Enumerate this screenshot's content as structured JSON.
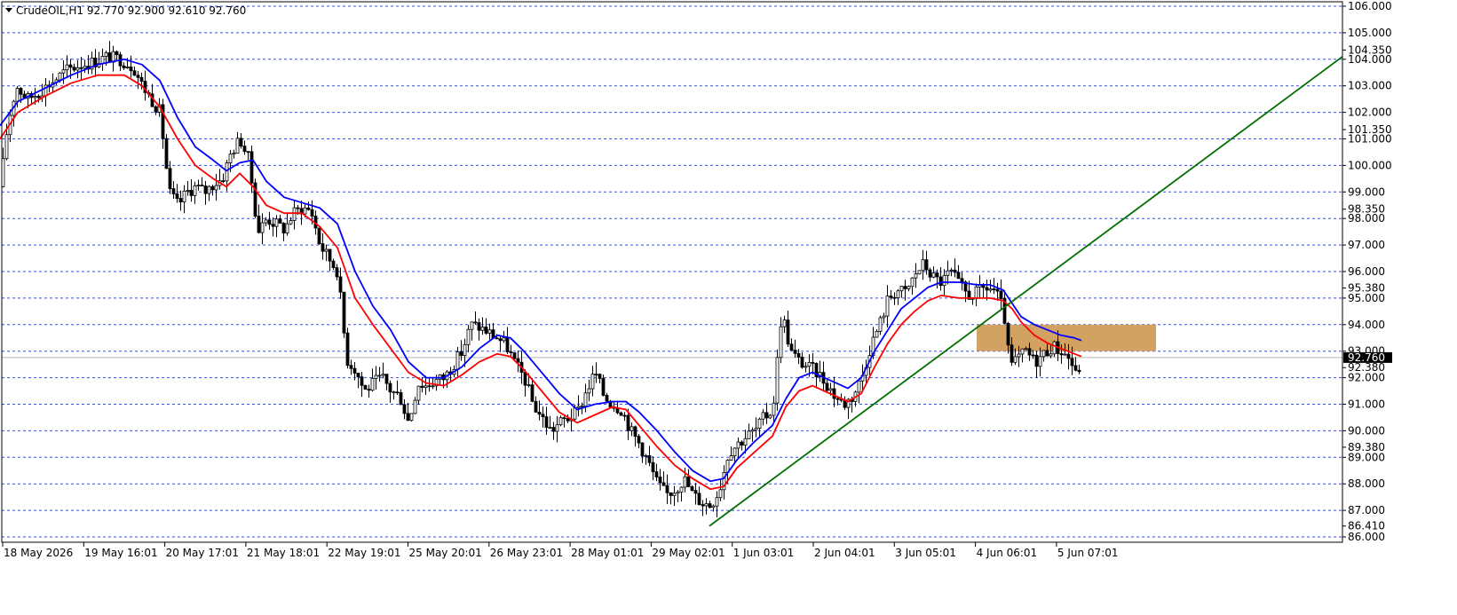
{
  "header": {
    "symbol_line": "CrudeOIL,H1  92.770 92.900 92.610 92.760"
  },
  "colors": {
    "background": "#ffffff",
    "grid": "#3b4fd0",
    "candle": "#000000",
    "ma_fast": "#ff0000",
    "ma_slow": "#0000ff",
    "trendline": "#007000",
    "zone_fill": "#d2a262",
    "current_price_bg": "#000000"
  },
  "chart_data": {
    "type": "candlestick",
    "ylim": [
      86.0,
      106.0
    ],
    "grid": true,
    "y_ticks": [
      "106.000",
      "105.000",
      "104.350",
      "104.000",
      "103.000",
      "102.000",
      "101.350",
      "101.000",
      "100.000",
      "99.000",
      "98.350",
      "98.000",
      "97.000",
      "96.000",
      "95.380",
      "95.000",
      "94.000",
      "93.000",
      "92.380",
      "92.000",
      "91.000",
      "90.000",
      "89.380",
      "89.000",
      "88.000",
      "87.000",
      "86.410",
      "86.000"
    ],
    "gridlines": [
      106,
      105,
      104,
      103,
      102,
      101,
      100,
      99,
      98,
      97,
      96,
      95,
      94,
      93,
      92,
      91,
      90,
      89,
      88,
      87,
      86
    ],
    "x_tick_labels": [
      "18 May 2026",
      "19 May 16:01",
      "20 May 17:01",
      "21 May 18:01",
      "22 May 19:01",
      "25 May 20:01",
      "26 May 23:01",
      "28 May 01:01",
      "29 May 02:01",
      "1 Jun 03:01",
      "2 Jun 04:01",
      "3 Jun 05:01",
      "4 Jun 06:01",
      "5 Jun 07:01"
    ],
    "current_price": "92.760",
    "close_path": [
      [
        0,
        99.2
      ],
      [
        8,
        101.5
      ],
      [
        18,
        103.0
      ],
      [
        30,
        102.5
      ],
      [
        45,
        102.8
      ],
      [
        60,
        103.2
      ],
      [
        75,
        103.6
      ],
      [
        90,
        103.8
      ],
      [
        105,
        103.9
      ],
      [
        120,
        104.1
      ],
      [
        135,
        104.0
      ],
      [
        150,
        103.7
      ],
      [
        160,
        103.0
      ],
      [
        170,
        102.5
      ],
      [
        180,
        102.0
      ],
      [
        190,
        99.0
      ],
      [
        200,
        98.5
      ],
      [
        210,
        99.0
      ],
      [
        220,
        99.2
      ],
      [
        230,
        99.0
      ],
      [
        240,
        99.3
      ],
      [
        250,
        99.5
      ],
      [
        260,
        100.5
      ],
      [
        270,
        101.0
      ],
      [
        280,
        100.2
      ],
      [
        290,
        97.5
      ],
      [
        300,
        98.0
      ],
      [
        310,
        97.8
      ],
      [
        320,
        97.6
      ],
      [
        330,
        98.2
      ],
      [
        340,
        98.4
      ],
      [
        350,
        98.3
      ],
      [
        360,
        97.0
      ],
      [
        370,
        96.5
      ],
      [
        380,
        96.0
      ],
      [
        390,
        92.7
      ],
      [
        400,
        92.3
      ],
      [
        410,
        91.5
      ],
      [
        420,
        91.8
      ],
      [
        430,
        92.0
      ],
      [
        440,
        91.5
      ],
      [
        450,
        91.3
      ],
      [
        460,
        90.3
      ],
      [
        470,
        91.8
      ],
      [
        480,
        91.7
      ],
      [
        490,
        91.9
      ],
      [
        500,
        92.0
      ],
      [
        510,
        92.5
      ],
      [
        520,
        93.0
      ],
      [
        530,
        94.0
      ],
      [
        540,
        93.9
      ],
      [
        550,
        93.7
      ],
      [
        560,
        93.5
      ],
      [
        570,
        93.2
      ],
      [
        580,
        92.5
      ],
      [
        590,
        92.0
      ],
      [
        600,
        91.0
      ],
      [
        610,
        90.5
      ],
      [
        620,
        90.0
      ],
      [
        630,
        90.3
      ],
      [
        640,
        90.5
      ],
      [
        650,
        90.7
      ],
      [
        660,
        91.5
      ],
      [
        670,
        92.2
      ],
      [
        680,
        91.3
      ],
      [
        690,
        91.0
      ],
      [
        700,
        90.8
      ],
      [
        710,
        90.0
      ],
      [
        720,
        89.5
      ],
      [
        730,
        88.8
      ],
      [
        740,
        88.0
      ],
      [
        750,
        87.6
      ],
      [
        760,
        87.8
      ],
      [
        770,
        88.2
      ],
      [
        780,
        87.6
      ],
      [
        790,
        87.3
      ],
      [
        800,
        87.2
      ],
      [
        810,
        87.8
      ],
      [
        820,
        89.2
      ],
      [
        830,
        89.5
      ],
      [
        840,
        89.8
      ],
      [
        850,
        90.0
      ],
      [
        860,
        90.5
      ],
      [
        870,
        90.8
      ],
      [
        880,
        94.5
      ],
      [
        890,
        93.0
      ],
      [
        900,
        92.6
      ],
      [
        910,
        92.4
      ],
      [
        920,
        92.2
      ],
      [
        930,
        91.8
      ],
      [
        940,
        91.3
      ],
      [
        950,
        91.0
      ],
      [
        960,
        91.3
      ],
      [
        970,
        92.0
      ],
      [
        980,
        93.2
      ],
      [
        990,
        94.0
      ],
      [
        1000,
        95.0
      ],
      [
        1010,
        95.3
      ],
      [
        1020,
        95.2
      ],
      [
        1030,
        95.9
      ],
      [
        1040,
        96.3
      ],
      [
        1050,
        95.8
      ],
      [
        1060,
        95.6
      ],
      [
        1070,
        96.0
      ],
      [
        1080,
        95.5
      ],
      [
        1090,
        95.1
      ],
      [
        1100,
        95.2
      ],
      [
        1110,
        95.4
      ],
      [
        1120,
        95.3
      ],
      [
        1130,
        94.5
      ],
      [
        1137,
        92.4
      ],
      [
        1145,
        92.7
      ],
      [
        1155,
        93.0
      ],
      [
        1165,
        92.6
      ],
      [
        1175,
        92.9
      ],
      [
        1185,
        93.2
      ],
      [
        1195,
        93.0
      ],
      [
        1205,
        92.7
      ],
      [
        1212,
        92.0
      ],
      [
        1218,
        92.76
      ]
    ],
    "ma_fast": [
      [
        0,
        101.0
      ],
      [
        20,
        102.0
      ],
      [
        50,
        102.6
      ],
      [
        80,
        103.1
      ],
      [
        110,
        103.4
      ],
      [
        140,
        103.4
      ],
      [
        160,
        103.0
      ],
      [
        180,
        102.2
      ],
      [
        200,
        101.0
      ],
      [
        220,
        100.0
      ],
      [
        240,
        99.5
      ],
      [
        255,
        99.2
      ],
      [
        270,
        99.7
      ],
      [
        285,
        99.2
      ],
      [
        300,
        98.5
      ],
      [
        320,
        98.2
      ],
      [
        340,
        98.2
      ],
      [
        360,
        97.7
      ],
      [
        380,
        96.9
      ],
      [
        400,
        95.0
      ],
      [
        420,
        94.0
      ],
      [
        440,
        93.1
      ],
      [
        460,
        92.2
      ],
      [
        480,
        91.8
      ],
      [
        500,
        91.7
      ],
      [
        520,
        92.1
      ],
      [
        540,
        92.6
      ],
      [
        560,
        92.9
      ],
      [
        575,
        92.8
      ],
      [
        590,
        92.3
      ],
      [
        610,
        91.5
      ],
      [
        630,
        90.7
      ],
      [
        650,
        90.3
      ],
      [
        670,
        90.6
      ],
      [
        690,
        90.9
      ],
      [
        705,
        90.8
      ],
      [
        720,
        90.2
      ],
      [
        740,
        89.4
      ],
      [
        760,
        88.7
      ],
      [
        780,
        88.2
      ],
      [
        800,
        87.8
      ],
      [
        815,
        87.9
      ],
      [
        830,
        88.6
      ],
      [
        850,
        89.2
      ],
      [
        870,
        89.8
      ],
      [
        885,
        90.9
      ],
      [
        900,
        91.5
      ],
      [
        915,
        91.7
      ],
      [
        935,
        91.4
      ],
      [
        955,
        91.1
      ],
      [
        970,
        91.4
      ],
      [
        985,
        92.4
      ],
      [
        1000,
        93.3
      ],
      [
        1015,
        94.0
      ],
      [
        1030,
        94.5
      ],
      [
        1045,
        94.9
      ],
      [
        1060,
        95.1
      ],
      [
        1080,
        95.0
      ],
      [
        1100,
        95.0
      ],
      [
        1115,
        95.0
      ],
      [
        1130,
        94.9
      ],
      [
        1140,
        94.6
      ],
      [
        1150,
        94.1
      ],
      [
        1165,
        93.6
      ],
      [
        1180,
        93.3
      ],
      [
        1195,
        93.1
      ],
      [
        1210,
        92.9
      ],
      [
        1218,
        92.8
      ]
    ],
    "ma_slow": [
      [
        0,
        101.5
      ],
      [
        20,
        102.4
      ],
      [
        50,
        102.9
      ],
      [
        80,
        103.4
      ],
      [
        110,
        103.8
      ],
      [
        140,
        104.0
      ],
      [
        160,
        103.8
      ],
      [
        180,
        103.2
      ],
      [
        200,
        101.8
      ],
      [
        220,
        100.7
      ],
      [
        240,
        100.2
      ],
      [
        255,
        99.8
      ],
      [
        270,
        100.1
      ],
      [
        285,
        100.2
      ],
      [
        300,
        99.4
      ],
      [
        320,
        98.8
      ],
      [
        340,
        98.6
      ],
      [
        360,
        98.4
      ],
      [
        380,
        97.8
      ],
      [
        400,
        96.0
      ],
      [
        420,
        94.7
      ],
      [
        440,
        93.8
      ],
      [
        460,
        92.6
      ],
      [
        480,
        92.0
      ],
      [
        500,
        92.0
      ],
      [
        520,
        92.4
      ],
      [
        540,
        93.1
      ],
      [
        560,
        93.6
      ],
      [
        575,
        93.5
      ],
      [
        590,
        93.0
      ],
      [
        610,
        92.2
      ],
      [
        630,
        91.4
      ],
      [
        650,
        90.8
      ],
      [
        670,
        91.0
      ],
      [
        690,
        91.1
      ],
      [
        705,
        91.1
      ],
      [
        720,
        90.7
      ],
      [
        740,
        90.0
      ],
      [
        760,
        89.2
      ],
      [
        780,
        88.5
      ],
      [
        800,
        88.1
      ],
      [
        815,
        88.2
      ],
      [
        830,
        88.9
      ],
      [
        850,
        89.6
      ],
      [
        870,
        90.2
      ],
      [
        885,
        91.2
      ],
      [
        900,
        92.0
      ],
      [
        915,
        92.2
      ],
      [
        935,
        91.9
      ],
      [
        955,
        91.6
      ],
      [
        970,
        92.0
      ],
      [
        985,
        93.0
      ],
      [
        1000,
        93.8
      ],
      [
        1015,
        94.6
      ],
      [
        1030,
        95.0
      ],
      [
        1045,
        95.4
      ],
      [
        1060,
        95.6
      ],
      [
        1080,
        95.6
      ],
      [
        1100,
        95.5
      ],
      [
        1115,
        95.5
      ],
      [
        1130,
        95.3
      ],
      [
        1140,
        94.8
      ],
      [
        1150,
        94.3
      ],
      [
        1165,
        94.0
      ],
      [
        1180,
        93.8
      ],
      [
        1195,
        93.6
      ],
      [
        1210,
        93.5
      ],
      [
        1218,
        93.4
      ]
    ],
    "trendline": {
      "start": [
        799,
        86.41
      ],
      "end": [
        1512,
        104.1
      ]
    },
    "zone": {
      "x_start": 1100,
      "x_end": 1302,
      "y_low": 93.0,
      "y_high": 94.0
    }
  }
}
